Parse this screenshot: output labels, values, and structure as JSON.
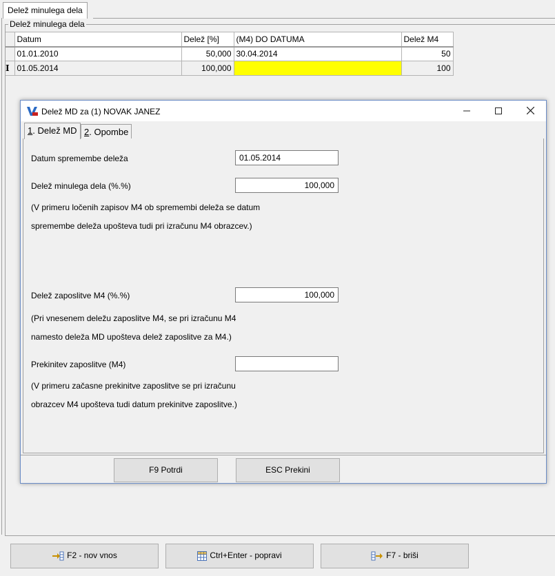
{
  "top_tab": {
    "label": "Delež minulega dela"
  },
  "group": {
    "legend": "Delež minulega dela"
  },
  "grid": {
    "columns": [
      "Datum",
      "Delež [%]",
      "(M4) DO DATUMA",
      "Delež M4"
    ],
    "rows": [
      {
        "indicator": "",
        "datum": "01.01.2010",
        "delez": "50,000",
        "do_datuma": "30.04.2014",
        "delez_m4": "50"
      },
      {
        "indicator": "I",
        "datum": "01.05.2014",
        "delez": "100,000",
        "do_datuma": "",
        "delez_m4": "100"
      }
    ]
  },
  "dialog": {
    "title": "Delež MD za (1) NOVAK JANEZ",
    "tabs": [
      {
        "num": "1",
        "label": ". Delež MD"
      },
      {
        "num": "2",
        "label": ". Opombe"
      }
    ],
    "fields": {
      "datum_label": "Datum spremembe deleža",
      "datum_value": "01.05.2014",
      "delez_label": "Delež minulega dela (%.%)",
      "delez_value": "100,000",
      "note1_line1": "(V primeru ločenih zapisov M4 ob spremembi deleža se datum",
      "note1_line2": "spremembe deleža upošteva tudi pri izračunu M4 obrazcev.)",
      "m4_label": "Delež zaposlitve M4 (%.%)",
      "m4_value": "100,000",
      "note2_line1": "(Pri vnesenem deležu zaposlitve M4, se pri  izračunu M4",
      "note2_line2": "namesto deleža MD upošteva delež zaposlitve za M4.)",
      "prek_label": "Prekinitev zaposlitve (M4)",
      "prek_value": "",
      "note3_line1": "(V primeru začasne prekinitve zaposlitve se pri izračunu",
      "note3_line2": "obrazcev M4 upošteva tudi datum prekinitve zaposlitve.)"
    },
    "buttons": {
      "confirm": "F9  Potrdi",
      "cancel": "ESC  Prekini"
    }
  },
  "bottom_buttons": {
    "new": "F2 - nov vnos",
    "edit": "Ctrl+Enter - popravi",
    "delete": "F7 - briši"
  },
  "colors": {
    "highlight": "#ffff00",
    "dialog_border": "#6a8cc6"
  }
}
